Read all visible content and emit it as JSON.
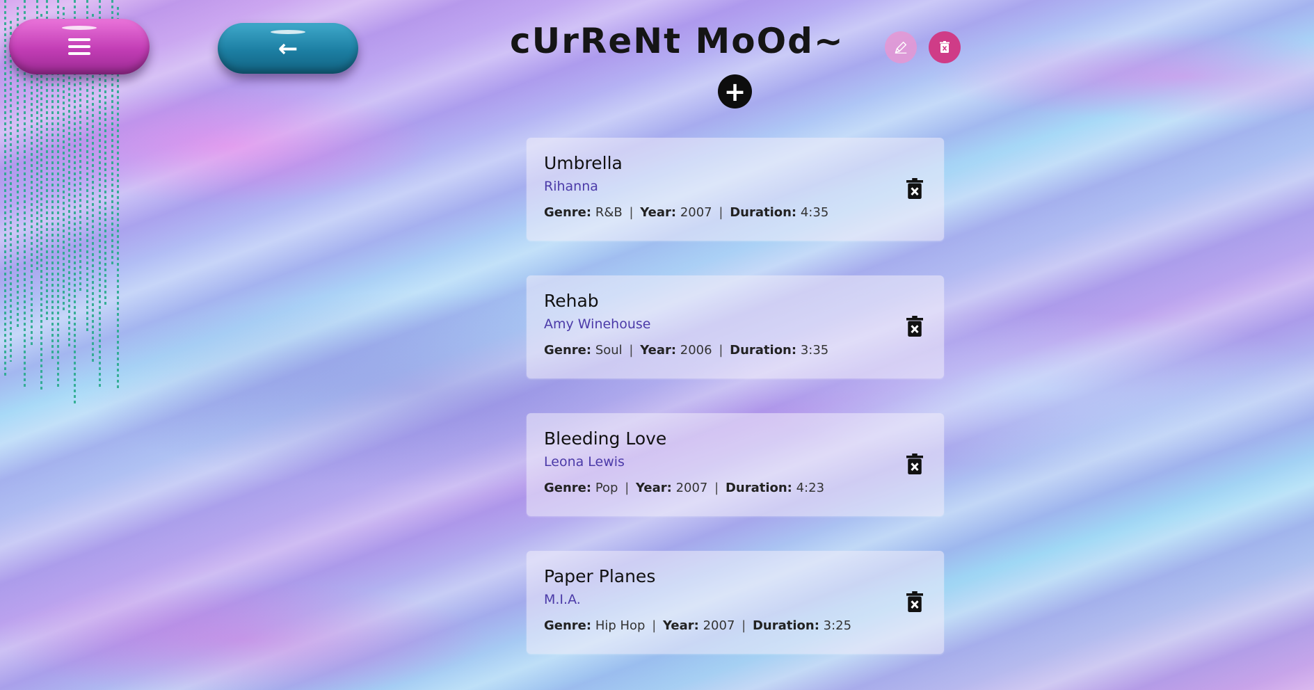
{
  "app": {
    "title": "cUrReNt MoOd~"
  },
  "nav": {
    "menu_icon": "hamburger-icon",
    "back_icon": "arrow-left-icon",
    "back_glyph": "←"
  },
  "actions": {
    "edit_icon": "pencil-icon",
    "clear_icon": "trash-icon",
    "add_icon": "plus-icon",
    "add_glyph": "+"
  },
  "labels": {
    "genre": "Genre:",
    "year": "Year:",
    "duration": "Duration:",
    "separator": "|"
  },
  "songs": [
    {
      "title": "Umbrella",
      "artist": "Rihanna",
      "genre": "R&B",
      "year": "2007",
      "duration": "4:35"
    },
    {
      "title": "Rehab",
      "artist": "Amy Winehouse",
      "genre": "Soul",
      "year": "2006",
      "duration": "3:35"
    },
    {
      "title": "Bleeding Love",
      "artist": "Leona Lewis",
      "genre": "Pop",
      "year": "2007",
      "duration": "4:23"
    },
    {
      "title": "Paper Planes",
      "artist": "M.I.A.",
      "genre": "Hip Hop",
      "year": "2007",
      "duration": "3:25"
    }
  ],
  "colors": {
    "menu_button": "#c23db5",
    "back_button": "#1c7ea2",
    "edit_button": "#e696d2",
    "clear_button": "#cf3c87",
    "artist_text": "#4b3aa8"
  }
}
